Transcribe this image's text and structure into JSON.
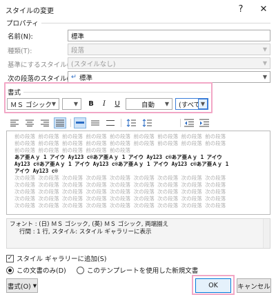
{
  "window": {
    "title": "スタイルの変更",
    "help_glyph": "?",
    "close_glyph": "✕"
  },
  "properties": {
    "heading": "プロパティ",
    "name_label": "名前(N):",
    "name_value": "標準",
    "type_label": "種類(T):",
    "type_value": "段落",
    "base_label": "基準にするスタイル(B):",
    "base_value": "(スタイルなし)",
    "next_label": "次の段落のスタイル(S):",
    "next_value": "標準",
    "next_icon_glyph": "↵"
  },
  "format": {
    "heading": "書式",
    "font": "ＭＳ ゴシック",
    "size": "",
    "bold": "B",
    "italic": "I",
    "underline": "U",
    "color": "自動",
    "script": "(すべて)"
  },
  "preview": {
    "lines": [
      {
        "style": "gray",
        "text": "前の段落 前の段落 前の段落 前の段落 前の段落 前の段落 前の段落 前の段落 前の段落"
      },
      {
        "style": "gray",
        "text": "前の段落 前の段落 前の段落 前の段落 前の段落 前の段落 前の段落 前の段落 前の段落"
      },
      {
        "style": "gray",
        "text": "前の段落 前の段落 前の段落 前の段落 前の段落"
      },
      {
        "style": "dark",
        "text": "あア亜Ａｙ 1 アイウ Ay123 c®あア亜Ａｙ 1 アイウ Ay123 c®あア亜Ａｙ 1 アイウ"
      },
      {
        "style": "dark",
        "text": "Ay123 c®あア亜Ａｙ 1 アイウ Ay123 c®あア亜Ａｙ 1 アイウ Ay123 c®あア亜Ａｙ 1"
      },
      {
        "style": "dark",
        "text": "アイウ Ay123 c®"
      },
      {
        "style": "gray",
        "text": "次の段落 次の段落 次の段落 次の段落 次の段落 次の段落 次の段落 次の段落 次の段落"
      },
      {
        "style": "gray",
        "text": "次の段落 次の段落 次の段落 次の段落 次の段落 次の段落 次の段落 次の段落 次の段落"
      },
      {
        "style": "gray",
        "text": "次の段落 次の段落 次の段落 次の段落 次の段落 次の段落 次の段落 次の段落 次の段落"
      },
      {
        "style": "gray",
        "text": "次の段落 次の段落 次の段落 次の段落 次の段落 次の段落 次の段落 次の段落 次の段落"
      },
      {
        "style": "gray",
        "text": "次の段落 次の段落 次の段落 次の段落 次の段落 次の段落 次の段落 次の段落 次の段落"
      }
    ]
  },
  "description": {
    "line1": "フォント : (日) ＭＳ ゴシック, (英) ＭＳ ゴシック, 両端揃え",
    "line2": "行間 : 1 行, スタイル: スタイル ギャラリーに表示"
  },
  "options": {
    "add_gallery_label": "スタイル ギャラリーに追加(S)",
    "add_gallery_checked": true,
    "this_doc_label": "この文書のみ(D)",
    "template_label": "このテンプレートを使用した新規文書"
  },
  "buttons": {
    "format_label": "書式(O)",
    "ok_label": "OK",
    "cancel_label": "キャンセル"
  },
  "colors": {
    "highlight": "#f2a7c6",
    "selected_align": "#cfe3f7",
    "default_button": "#0078d7"
  }
}
